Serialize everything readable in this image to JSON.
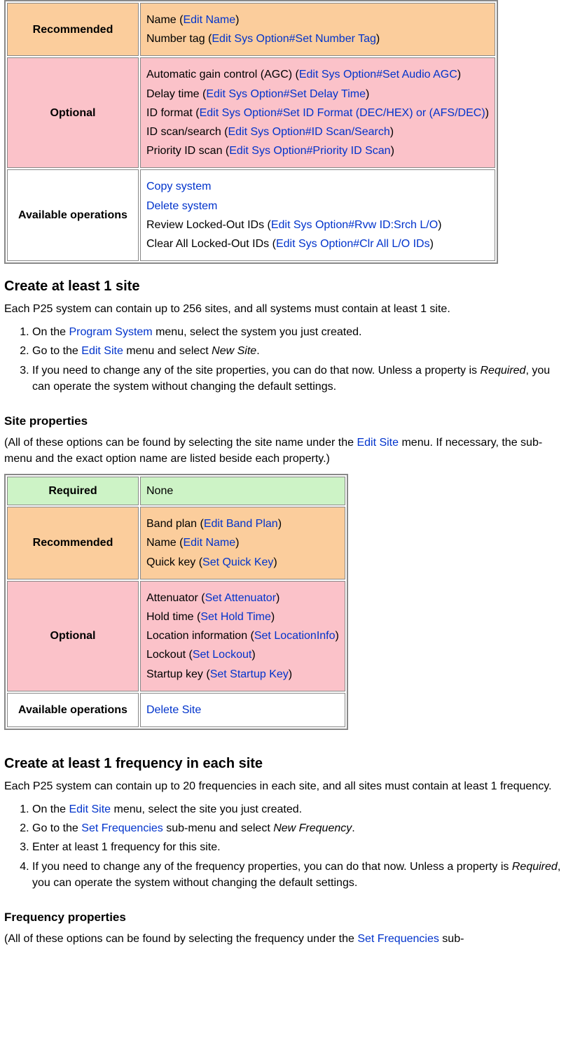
{
  "labels": {
    "required": "Required",
    "recommended": "Recommended",
    "optional": "Optional",
    "operations": "Available operations",
    "none": "None"
  },
  "sysRecommended": [
    {
      "text": "Name",
      "link": "Edit Name"
    },
    {
      "text": "Number tag",
      "link": "Edit Sys Option#Set Number Tag"
    }
  ],
  "sysOptional": [
    {
      "text": "Automatic gain control (AGC)",
      "link": "Edit Sys Option#Set Audio AGC"
    },
    {
      "text": "Delay time",
      "link": "Edit Sys Option#Set Delay Time"
    },
    {
      "text": "ID format",
      "link": "Edit Sys Option#Set ID Format (DEC/HEX) or (AFS/DEC)"
    },
    {
      "text": "ID scan/search",
      "link": "Edit Sys Option#ID Scan/Search"
    },
    {
      "text": "Priority ID scan",
      "link": "Edit Sys Option#Priority ID Scan"
    }
  ],
  "sysOperations": [
    {
      "plainLink": "Copy system"
    },
    {
      "plainLink": "Delete system"
    },
    {
      "text": "Review Locked-Out IDs",
      "link": "Edit Sys Option#Rvw ID:Srch L/O"
    },
    {
      "text": "Clear All Locked-Out IDs",
      "link": "Edit Sys Option#Clr All L/O IDs"
    }
  ],
  "siteHeading": "Create at least 1 site",
  "siteIntro": "Each P25 system can contain up to 256 sites, and all systems must contain at least 1 site.",
  "siteSteps": {
    "s1a": "On the ",
    "s1link": "Program System",
    "s1b": " menu, select the system you just created.",
    "s2a": "Go to the ",
    "s2link": "Edit Site",
    "s2b": " menu and select ",
    "s2em": "New Site",
    "s2c": ".",
    "s3a": "If you need to change any of the site properties, you can do that now. Unless a property is ",
    "s3em": "Required",
    "s3b": ", you can operate the system without changing the default settings."
  },
  "sitePropsHeading": "Site properties",
  "sitePropsIntroA": "(All of these options can be found by selecting the site name under the ",
  "sitePropsIntroLink": "Edit Site",
  "sitePropsIntroB": " menu. If necessary, the sub-menu and the exact option name are listed beside each property.)",
  "siteRecommended": [
    {
      "text": "Band plan",
      "link": "Edit Band Plan"
    },
    {
      "text": "Name",
      "link": "Edit Name"
    },
    {
      "text": "Quick key",
      "link": "Set Quick Key"
    }
  ],
  "siteOptional": [
    {
      "text": "Attenuator",
      "link": "Set Attenuator"
    },
    {
      "text": "Hold time",
      "link": "Set Hold Time"
    },
    {
      "text": "Location information",
      "link": "Set LocationInfo"
    },
    {
      "text": "Lockout",
      "link": "Set Lockout"
    },
    {
      "text": "Startup key",
      "link": "Set Startup Key"
    }
  ],
  "siteOperations": [
    {
      "plainLink": "Delete Site"
    }
  ],
  "freqHeading": "Create at least 1 frequency in each site",
  "freqIntro": "Each P25 system can contain up to 20 frequencies in each site, and all sites must contain at least 1 frequency.",
  "freqSteps": {
    "s1a": "On the ",
    "s1link": "Edit Site",
    "s1b": " menu, select the site you just created.",
    "s2a": "Go to the ",
    "s2link": "Set Frequencies",
    "s2b": " sub-menu and select ",
    "s2em": "New Frequency",
    "s2c": ".",
    "s3": "Enter at least 1 frequency for this site.",
    "s4a": "If you need to change any of the frequency properties, you can do that now. Unless a property is ",
    "s4em": "Required",
    "s4b": ", you can operate the system without changing the default settings."
  },
  "freqPropsHeading": "Frequency properties",
  "freqPropsIntroA": "(All of these options can be found by selecting the frequency under the ",
  "freqPropsIntroLink": "Set Frequencies",
  "freqPropsIntroB": " sub-"
}
